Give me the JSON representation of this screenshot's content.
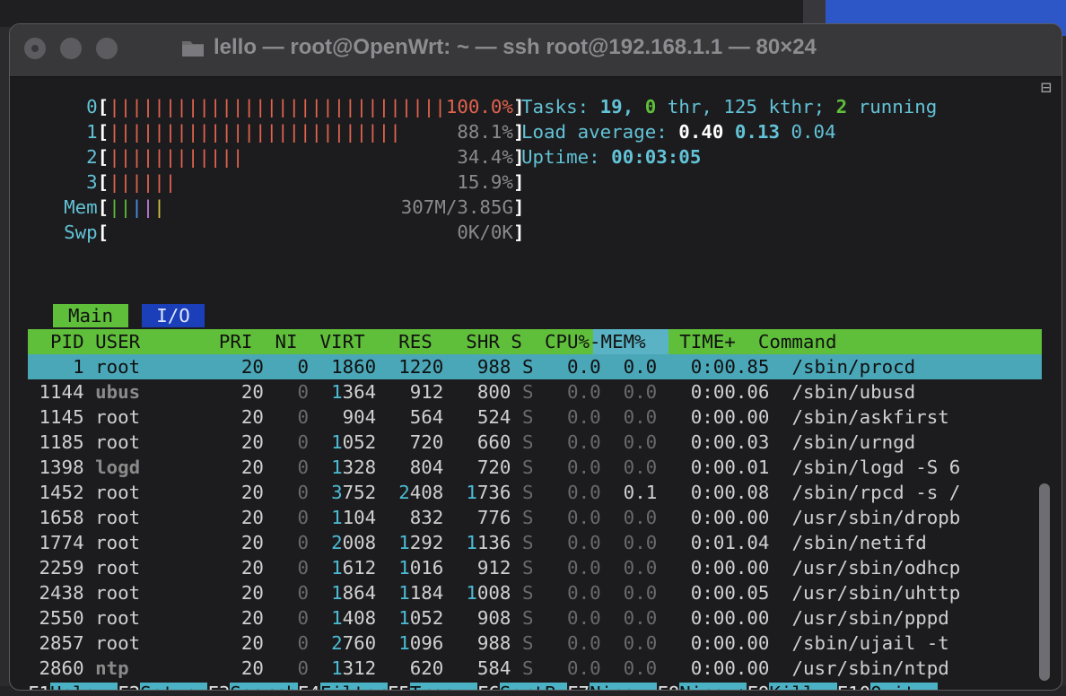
{
  "window": {
    "title": "lello — root@OpenWrt: ~ — ssh root@192.168.1.1 — 80×24"
  },
  "meters": {
    "cpu": [
      {
        "label": "0",
        "bars": 30,
        "value": "100.0%"
      },
      {
        "label": "1",
        "bars": 26,
        "value": "88.1%"
      },
      {
        "label": "2",
        "bars": 12,
        "value": "34.4%"
      },
      {
        "label": "3",
        "bars": 6,
        "value": "15.9%"
      }
    ],
    "mem": {
      "label": "Mem",
      "value": "307M/3.85G"
    },
    "swp": {
      "label": "Swp",
      "value": "0K/0K"
    }
  },
  "summary": {
    "tasks_label": "Tasks:",
    "tasks": "19,",
    "thr": "0",
    "thr_label": "thr,",
    "kthr": "125 kthr;",
    "running": "2",
    "running_label": "running",
    "load_label": "Load average:",
    "load1": "0.40",
    "load5": "0.13",
    "load15": "0.04",
    "uptime_label": "Uptime:",
    "uptime": "00:03:05"
  },
  "tabs": {
    "main": "Main",
    "io": "I/O"
  },
  "columns": {
    "header": "  PID USER       PRI  NI  VIRT   RES   SHR S  CPU%-MEM%   TIME+  Command"
  },
  "processes": [
    {
      "pid": "1",
      "user": "root",
      "pri": "20",
      "ni": "0",
      "virt": "1860",
      "res": "1220",
      "shr": "988",
      "s": "S",
      "cpu": "0.0",
      "mem": "0.0",
      "time": "0:00.85",
      "cmd": "/sbin/procd",
      "dim_user": false
    },
    {
      "pid": "1144",
      "user": "ubus",
      "pri": "20",
      "ni": "0",
      "virt": "1364",
      "res": "912",
      "shr": "800",
      "s": "S",
      "cpu": "0.0",
      "mem": "0.0",
      "time": "0:00.06",
      "cmd": "/sbin/ubusd",
      "dim_user": true
    },
    {
      "pid": "1145",
      "user": "root",
      "pri": "20",
      "ni": "0",
      "virt": "904",
      "res": "564",
      "shr": "524",
      "s": "S",
      "cpu": "0.0",
      "mem": "0.0",
      "time": "0:00.00",
      "cmd": "/sbin/askfirst",
      "dim_user": false
    },
    {
      "pid": "1185",
      "user": "root",
      "pri": "20",
      "ni": "0",
      "virt": "1052",
      "res": "720",
      "shr": "660",
      "s": "S",
      "cpu": "0.0",
      "mem": "0.0",
      "time": "0:00.03",
      "cmd": "/sbin/urngd",
      "dim_user": false
    },
    {
      "pid": "1398",
      "user": "logd",
      "pri": "20",
      "ni": "0",
      "virt": "1328",
      "res": "804",
      "shr": "720",
      "s": "S",
      "cpu": "0.0",
      "mem": "0.0",
      "time": "0:00.01",
      "cmd": "/sbin/logd -S 6",
      "dim_user": true
    },
    {
      "pid": "1452",
      "user": "root",
      "pri": "20",
      "ni": "0",
      "virt": "3752",
      "res": "2408",
      "shr": "1736",
      "s": "S",
      "cpu": "0.0",
      "mem": "0.1",
      "time": "0:00.08",
      "cmd": "/sbin/rpcd -s /",
      "dim_user": false
    },
    {
      "pid": "1658",
      "user": "root",
      "pri": "20",
      "ni": "0",
      "virt": "1104",
      "res": "832",
      "shr": "776",
      "s": "S",
      "cpu": "0.0",
      "mem": "0.0",
      "time": "0:00.00",
      "cmd": "/usr/sbin/dropb",
      "dim_user": false
    },
    {
      "pid": "1774",
      "user": "root",
      "pri": "20",
      "ni": "0",
      "virt": "2008",
      "res": "1292",
      "shr": "1136",
      "s": "S",
      "cpu": "0.0",
      "mem": "0.0",
      "time": "0:01.04",
      "cmd": "/sbin/netifd",
      "dim_user": false
    },
    {
      "pid": "2259",
      "user": "root",
      "pri": "20",
      "ni": "0",
      "virt": "1612",
      "res": "1016",
      "shr": "912",
      "s": "S",
      "cpu": "0.0",
      "mem": "0.0",
      "time": "0:00.00",
      "cmd": "/usr/sbin/odhcp",
      "dim_user": false
    },
    {
      "pid": "2438",
      "user": "root",
      "pri": "20",
      "ni": "0",
      "virt": "1864",
      "res": "1184",
      "shr": "1008",
      "s": "S",
      "cpu": "0.0",
      "mem": "0.0",
      "time": "0:00.05",
      "cmd": "/usr/sbin/uhttp",
      "dim_user": false
    },
    {
      "pid": "2550",
      "user": "root",
      "pri": "20",
      "ni": "0",
      "virt": "1408",
      "res": "1052",
      "shr": "908",
      "s": "S",
      "cpu": "0.0",
      "mem": "0.0",
      "time": "0:00.00",
      "cmd": "/usr/sbin/pppd",
      "dim_user": false
    },
    {
      "pid": "2857",
      "user": "root",
      "pri": "20",
      "ni": "0",
      "virt": "2760",
      "res": "1096",
      "shr": "988",
      "s": "S",
      "cpu": "0.0",
      "mem": "0.0",
      "time": "0:00.00",
      "cmd": "/sbin/ujail -t",
      "dim_user": false
    },
    {
      "pid": "2860",
      "user": "ntp",
      "pri": "20",
      "ni": "0",
      "virt": "1312",
      "res": "620",
      "shr": "584",
      "s": "S",
      "cpu": "0.0",
      "mem": "0.0",
      "time": "0:00.00",
      "cmd": "/usr/sbin/ntpd",
      "dim_user": true
    }
  ],
  "footer": [
    {
      "key": "F1",
      "label": "Help  "
    },
    {
      "key": "F2",
      "label": "Setup "
    },
    {
      "key": "F3",
      "label": "Search"
    },
    {
      "key": "F4",
      "label": "Filter"
    },
    {
      "key": "F5",
      "label": "Tree  "
    },
    {
      "key": "F6",
      "label": "SortBy"
    },
    {
      "key": "F7",
      "label": "Nice -"
    },
    {
      "key": "F8",
      "label": "Nice +"
    },
    {
      "key": "F9",
      "label": "Kill  "
    },
    {
      "key": "F10",
      "label": "Quit  "
    }
  ],
  "colors": {
    "accent_green": "#5fbf3a",
    "selection": "#4aa7b8",
    "bar_red": "#e2634f",
    "cyan": "#62c2d6"
  }
}
